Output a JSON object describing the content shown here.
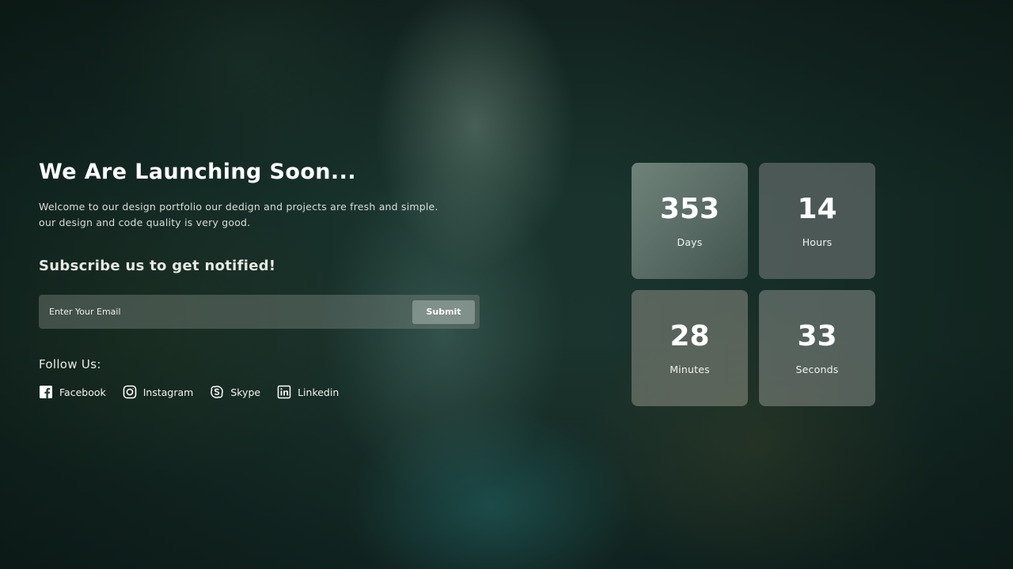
{
  "hero": {
    "title": "We Are Launching Soon...",
    "description_line1": "Welcome to our design portfolio our dedign and projects are fresh and simple.",
    "description_line2": "our design and code quality is very good."
  },
  "subscribe": {
    "heading": "Subscribe us to get notified!",
    "email_placeholder": "Enter Your Email",
    "submit_label": "Submit"
  },
  "follow": {
    "label": "Follow Us:",
    "links": [
      {
        "label": "Facebook",
        "icon": "facebook-icon"
      },
      {
        "label": "Instagram",
        "icon": "instagram-icon"
      },
      {
        "label": "Skype",
        "icon": "skype-icon"
      },
      {
        "label": "Linkedin",
        "icon": "linkedin-icon"
      }
    ]
  },
  "countdown": [
    {
      "value": "353",
      "unit": "Days"
    },
    {
      "value": "14",
      "unit": "Hours"
    },
    {
      "value": "28",
      "unit": "Minutes"
    },
    {
      "value": "33",
      "unit": "Seconds"
    }
  ]
}
